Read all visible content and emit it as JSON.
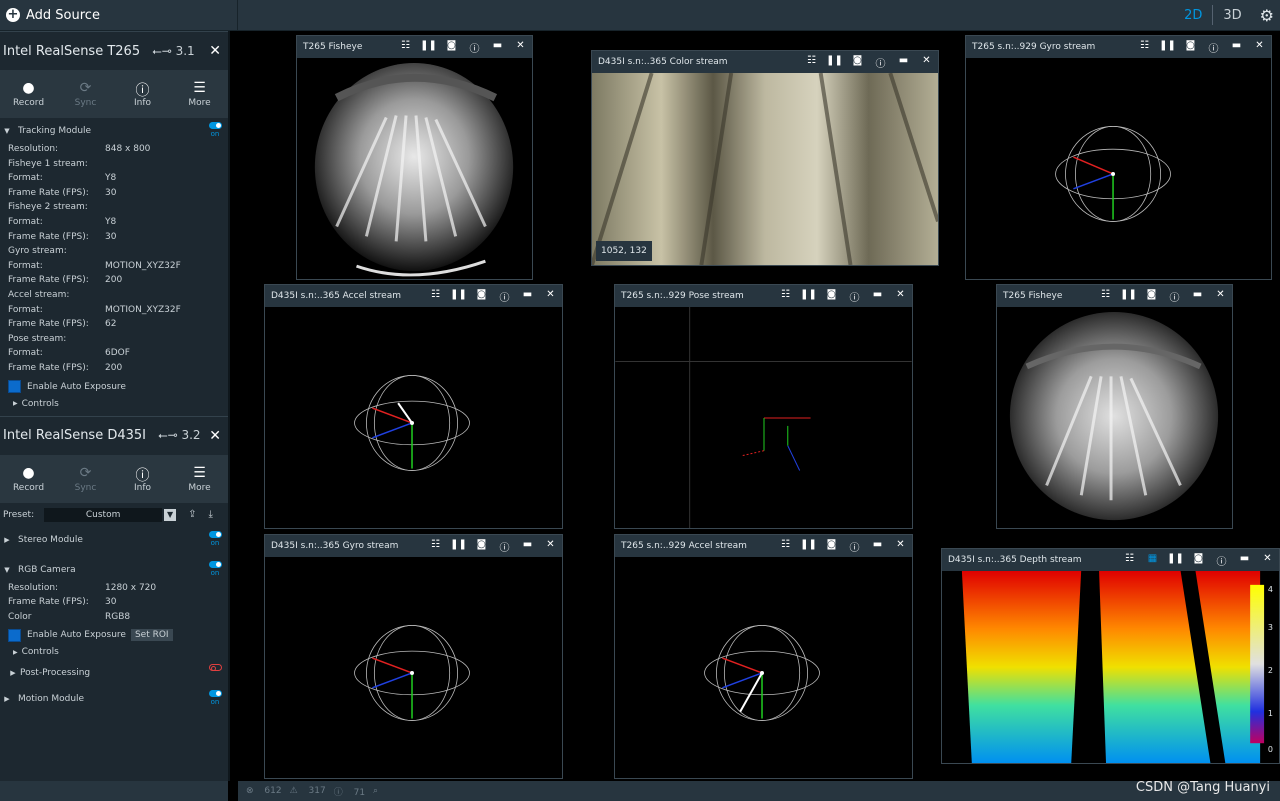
{
  "topbar": {
    "add_source": "Add Source",
    "view_2d": "2D",
    "view_3d": "3D",
    "icons": {
      "add": "plus-circle-icon",
      "settings": "gear-icon"
    }
  },
  "devices": [
    {
      "name": "Intel RealSense T265",
      "usb": "3.1",
      "buttons": [
        "Record",
        "Sync",
        "Info",
        "More"
      ],
      "modules": [
        {
          "name": "Tracking Module",
          "toggle": "on",
          "properties": [
            [
              "Resolution:",
              "848 x 800"
            ],
            [
              "Fisheye 1 stream:",
              ""
            ],
            [
              "Format:",
              "Y8"
            ],
            [
              "Frame Rate (FPS):",
              "30"
            ],
            [
              "Fisheye 2 stream:",
              ""
            ],
            [
              "Format:",
              "Y8"
            ],
            [
              "Frame Rate (FPS):",
              "30"
            ],
            [
              "Gyro stream:",
              ""
            ],
            [
              "Format:",
              "MOTION_XYZ32F"
            ],
            [
              "Frame Rate (FPS):",
              "200"
            ],
            [
              "Accel stream:",
              ""
            ],
            [
              "Format:",
              "MOTION_XYZ32F"
            ],
            [
              "Frame Rate (FPS):",
              "62"
            ],
            [
              "Pose stream:",
              ""
            ],
            [
              "Format:",
              "6DOF"
            ],
            [
              "Frame Rate (FPS):",
              "200"
            ]
          ],
          "auto_exposure": "Enable Auto Exposure",
          "controls": "Controls"
        }
      ]
    },
    {
      "name": "Intel RealSense D435I",
      "usb": "3.2",
      "buttons": [
        "Record",
        "Sync",
        "Info",
        "More"
      ],
      "preset_label": "Preset:",
      "preset_value": "Custom",
      "modules": [
        {
          "name": "Stereo Module",
          "toggle": "on"
        },
        {
          "name": "RGB Camera",
          "toggle": "on",
          "properties": [
            [
              "Resolution:",
              "1280 x 720"
            ],
            [
              "Frame Rate (FPS):",
              "30"
            ],
            [
              "Color",
              "RGB8"
            ]
          ],
          "auto_exposure": "Enable Auto Exposure",
          "set_roi": "Set ROI",
          "controls": "Controls",
          "post_processing": "Post-Processing"
        },
        {
          "name": "Motion Module",
          "toggle": "on"
        }
      ]
    }
  ],
  "streams": {
    "t265_fisheye_a": {
      "title": "T265 Fisheye"
    },
    "d435_color": {
      "title": "D435I s.n:..365 Color stream",
      "coord": "1052, 132"
    },
    "t265_gyro": {
      "title": "T265 s.n:..929 Gyro stream"
    },
    "d435_accel": {
      "title": "D435I s.n:..365 Accel stream"
    },
    "t265_pose": {
      "title": "T265 s.n:..929 Pose stream"
    },
    "t265_fisheye_b": {
      "title": "T265 Fisheye"
    },
    "d435_gyro": {
      "title": "D435I s.n:..365 Gyro stream"
    },
    "t265_accel": {
      "title": "T265 s.n:..929 Accel stream"
    },
    "d435_depth": {
      "title": "D435I s.n:..365 Depth stream",
      "scale": [
        "4",
        "3",
        "2",
        "1",
        "0"
      ]
    }
  },
  "statusbar": {
    "errors": "612",
    "warnings": "317",
    "info": "71"
  },
  "watermark": "CSDN @Tang Huanyi",
  "colors": {
    "accent": "#0096e0",
    "panel": "#1d2830",
    "titlebar": "#27353f"
  }
}
